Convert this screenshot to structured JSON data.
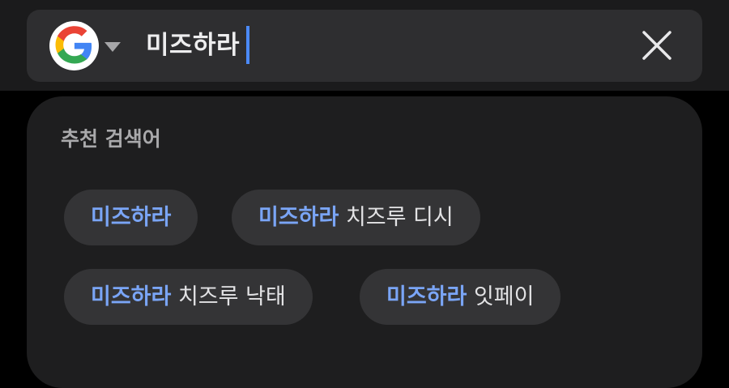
{
  "search": {
    "query": "미즈하라",
    "engine_icon": "google-g-icon",
    "dropdown_icon": "caret-down-icon",
    "clear_icon": "close-icon"
  },
  "suggestions": {
    "title": "추천 검색어",
    "items": [
      {
        "highlight": "미즈하라",
        "rest": ""
      },
      {
        "highlight": "미즈하라",
        "rest": " 치즈루 디시"
      },
      {
        "highlight": "미즈하라",
        "rest": " 치즈루 낙태"
      },
      {
        "highlight": "미즈하라",
        "rest": " 잇페이"
      }
    ]
  },
  "colors": {
    "background": "#000000",
    "top_bar": "#1b1b1c",
    "search_box": "#2e2e30",
    "panel": "#1e1e1f",
    "chip": "#343436",
    "highlight": "#7aa5f6",
    "caret": "#4b8af8"
  }
}
